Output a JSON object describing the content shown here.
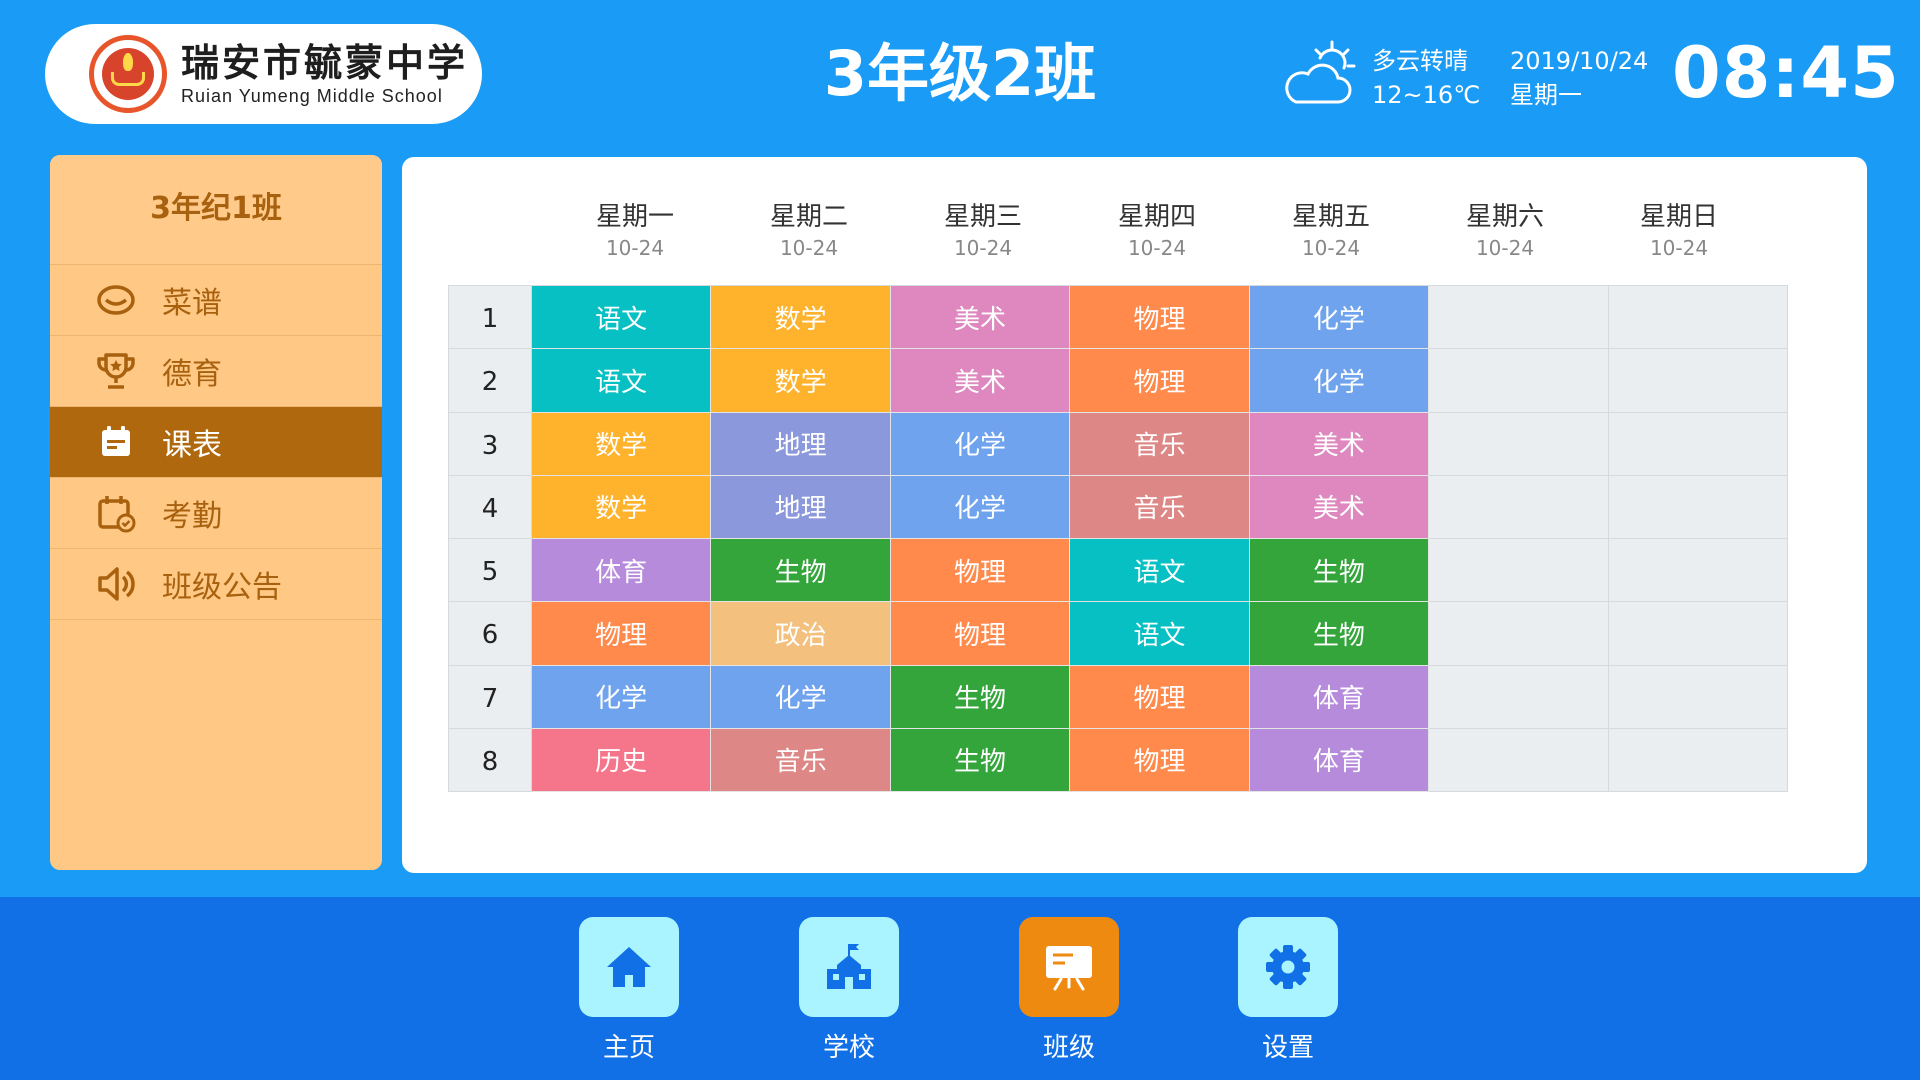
{
  "header": {
    "school_name_cn": "瑞安市毓蒙中学",
    "school_name_en": "Ruian Yumeng Middle School",
    "class_title": "3年级2班",
    "weather": {
      "condition": "多云转晴",
      "temperature": "12~16℃",
      "icon": "cloud-sun-icon"
    },
    "date": "2019/10/24",
    "weekday": "星期一",
    "time": "08:45"
  },
  "sidebar": {
    "title": "3年纪1班",
    "items": [
      {
        "label": "菜谱",
        "icon": "bowl-icon",
        "active": false
      },
      {
        "label": "德育",
        "icon": "trophy-icon",
        "active": false
      },
      {
        "label": "课表",
        "icon": "calendar-icon",
        "active": true
      },
      {
        "label": "考勤",
        "icon": "calendar-check-icon",
        "active": false
      },
      {
        "label": "班级公告",
        "icon": "speaker-icon",
        "active": false
      }
    ]
  },
  "timetable": {
    "days": [
      {
        "name": "星期一",
        "date": "10-24"
      },
      {
        "name": "星期二",
        "date": "10-24"
      },
      {
        "name": "星期三",
        "date": "10-24"
      },
      {
        "name": "星期四",
        "date": "10-24"
      },
      {
        "name": "星期五",
        "date": "10-24"
      },
      {
        "name": "星期六",
        "date": "10-24"
      },
      {
        "name": "星期日",
        "date": "10-24"
      }
    ],
    "periods": [
      "1",
      "2",
      "3",
      "4",
      "5",
      "6",
      "7",
      "8"
    ],
    "rows": [
      [
        "语文",
        "数学",
        "美术",
        "物理",
        "化学",
        "",
        ""
      ],
      [
        "语文",
        "数学",
        "美术",
        "物理",
        "化学",
        "",
        ""
      ],
      [
        "数学",
        "地理",
        "化学",
        "音乐",
        "美术",
        "",
        ""
      ],
      [
        "数学",
        "地理",
        "化学",
        "音乐",
        "美术",
        "",
        ""
      ],
      [
        "体育",
        "生物",
        "物理",
        "语文",
        "生物",
        "",
        ""
      ],
      [
        "物理",
        "政治",
        "物理",
        "语文",
        "生物",
        "",
        ""
      ],
      [
        "化学",
        "化学",
        "生物",
        "物理",
        "体育",
        "",
        ""
      ],
      [
        "历史",
        "音乐",
        "生物",
        "物理",
        "体育",
        "",
        ""
      ]
    ],
    "subject_colors": {
      "语文": "#07c0c3",
      "数学": "#ffb22c",
      "美术": "#de88bf",
      "物理": "#ff8a4c",
      "化学": "#6fa3ee",
      "地理": "#8c98dc",
      "音乐": "#dd8886",
      "体育": "#b68bdc",
      "生物": "#33a53a",
      "政治": "#f3c07e",
      "历史": "#f5768b"
    }
  },
  "bottom_nav": [
    {
      "label": "主页",
      "icon": "home-icon",
      "active": false
    },
    {
      "label": "学校",
      "icon": "school-icon",
      "active": false
    },
    {
      "label": "班级",
      "icon": "whiteboard-icon",
      "active": true
    },
    {
      "label": "设置",
      "icon": "gear-icon",
      "active": false
    }
  ]
}
